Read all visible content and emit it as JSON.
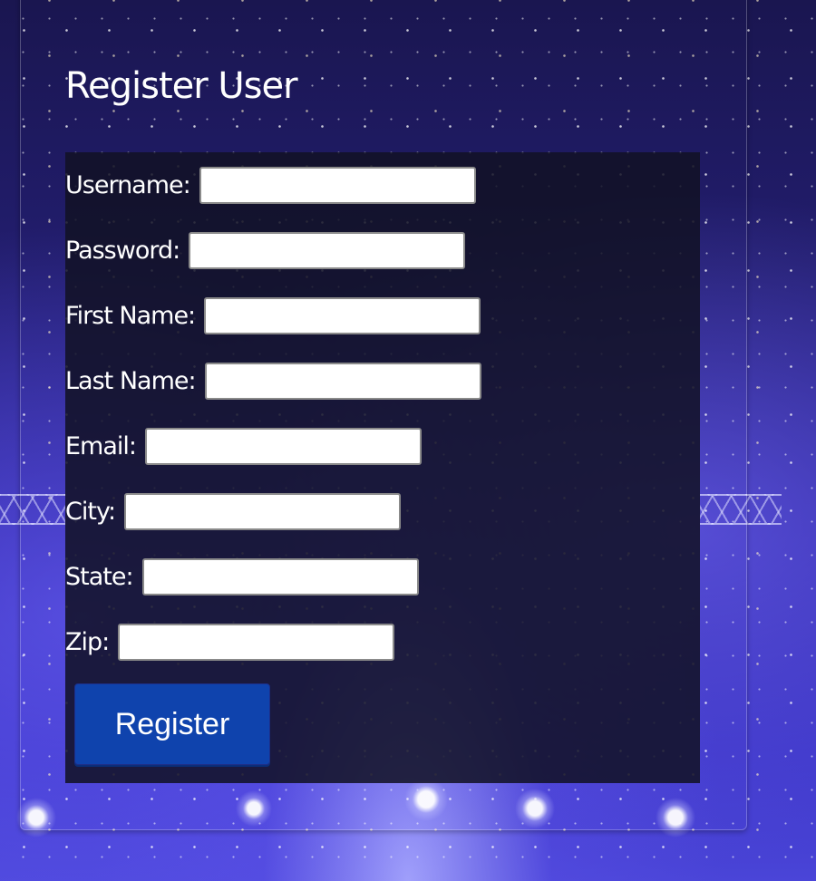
{
  "page": {
    "title": "Register User"
  },
  "form": {
    "fields": [
      {
        "label": "Username:",
        "value": "",
        "placeholder": ""
      },
      {
        "label": "Password:",
        "value": "",
        "placeholder": ""
      },
      {
        "label": "First Name:",
        "value": "",
        "placeholder": ""
      },
      {
        "label": "Last Name:",
        "value": "",
        "placeholder": ""
      },
      {
        "label": "Email:",
        "value": "",
        "placeholder": ""
      },
      {
        "label": "City:",
        "value": "",
        "placeholder": ""
      },
      {
        "label": "State:",
        "value": "",
        "placeholder": ""
      },
      {
        "label": "Zip:",
        "value": "",
        "placeholder": ""
      }
    ],
    "submit_label": "Register"
  },
  "colors": {
    "button": "#0f43ad",
    "form_background": "#121124",
    "text": "#ffffff"
  }
}
